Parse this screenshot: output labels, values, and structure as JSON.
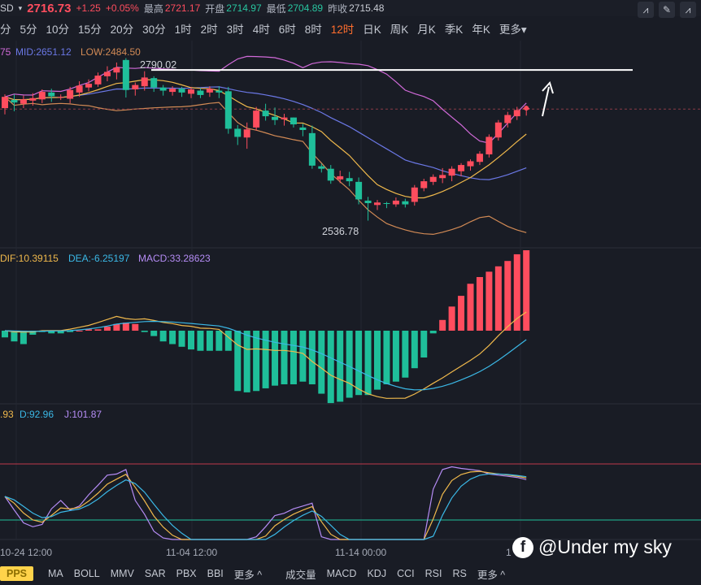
{
  "header": {
    "symbol": "SD",
    "price": "2716.73",
    "change": "+1.25",
    "change_pct": "+0.05%",
    "high_label": "最高",
    "high": "2721.17",
    "open_label": "开盘",
    "open": "2714.97",
    "low_label": "最低",
    "low": "2704.89",
    "prev_label": "昨收",
    "prev": "2715.48"
  },
  "periods": [
    "分",
    "5分",
    "10分",
    "15分",
    "20分",
    "30分",
    "1时",
    "2时",
    "3时",
    "4时",
    "6时",
    "8时",
    "12时",
    "日K",
    "周K",
    "月K",
    "季K",
    "年K",
    "更多"
  ],
  "active_period": "12时",
  "main_indicator": {
    "up": "75",
    "mid": "MID:2651.12",
    "low": "LOW:2484.50"
  },
  "macd_indicator": {
    "dif": "DIF:10.39115",
    "dea": "DEA:-6.25197",
    "macd": "MACD:33.28623"
  },
  "kdj_indicator": {
    "k": ".93",
    "d": "D:92.96",
    "j": "J:101.87"
  },
  "annotations": {
    "high_mark": "2790.02",
    "low_mark": "2536.78"
  },
  "time_axis": [
    "10-24 12:00",
    "11-04 12:00",
    "11-14 00:00",
    "1"
  ],
  "bottom_tabs": {
    "left": [
      "PPS",
      "MA",
      "BOLL",
      "MMV",
      "SAR",
      "PBX",
      "BBI",
      "更多"
    ],
    "right": [
      "成交量",
      "MACD",
      "KDJ",
      "CCI",
      "RSI",
      "RS",
      "更多"
    ]
  },
  "watermark": "@Under my sky",
  "colors": {
    "up": "#ff4d5e",
    "down": "#1fbf9a",
    "mid": "#6b78e6",
    "upper": "#d16ad9",
    "lower": "#d28a55",
    "ma": "#f0b94c",
    "dea": "#3bb8e6",
    "j": "#b58cf5"
  },
  "chart_data": {
    "type": "candlestick",
    "price_range": [
      2500,
      2825
    ],
    "resistance_level": 2778,
    "candles": [
      [
        2717,
        2735,
        2707,
        2739
      ],
      [
        2730,
        2726,
        2712,
        2739
      ],
      [
        2724,
        2731,
        2717,
        2737
      ],
      [
        2729,
        2733,
        2721,
        2741
      ],
      [
        2731,
        2743,
        2725,
        2747
      ],
      [
        2742,
        2736,
        2727,
        2748
      ],
      [
        2735,
        2735,
        2730,
        2739
      ],
      [
        2732,
        2746,
        2725,
        2751
      ],
      [
        2742,
        2753,
        2735,
        2760
      ],
      [
        2750,
        2756,
        2744,
        2763
      ],
      [
        2755,
        2769,
        2751,
        2774
      ],
      [
        2768,
        2775,
        2760,
        2784
      ],
      [
        2774,
        2782,
        2763,
        2790
      ],
      [
        2794,
        2746,
        2734,
        2797
      ],
      [
        2747,
        2754,
        2737,
        2758
      ],
      [
        2752,
        2766,
        2745,
        2776
      ],
      [
        2765,
        2750,
        2743,
        2768
      ],
      [
        2750,
        2745,
        2737,
        2754
      ],
      [
        2743,
        2748,
        2737,
        2752
      ],
      [
        2748,
        2742,
        2735,
        2751
      ],
      [
        2740,
        2747,
        2733,
        2751
      ],
      [
        2745,
        2738,
        2733,
        2749
      ],
      [
        2742,
        2748,
        2735,
        2752
      ],
      [
        2745,
        2742,
        2733,
        2752
      ],
      [
        2744,
        2684,
        2676,
        2751
      ],
      [
        2684,
        2671,
        2658,
        2690
      ],
      [
        2670,
        2683,
        2652,
        2694
      ],
      [
        2686,
        2713,
        2681,
        2719
      ],
      [
        2713,
        2704,
        2697,
        2724
      ],
      [
        2703,
        2698,
        2690,
        2718
      ],
      [
        2699,
        2702,
        2689,
        2708
      ],
      [
        2702,
        2691,
        2686,
        2702
      ],
      [
        2686,
        2682,
        2672,
        2692
      ],
      [
        2677,
        2625,
        2620,
        2689
      ],
      [
        2624,
        2620,
        2614,
        2628
      ],
      [
        2620,
        2601,
        2596,
        2626
      ],
      [
        2603,
        2608,
        2597,
        2617
      ],
      [
        2605,
        2600,
        2592,
        2615
      ],
      [
        2599,
        2571,
        2563,
        2606
      ],
      [
        2569,
        2565,
        2537,
        2575
      ],
      [
        2562,
        2566,
        2554,
        2570
      ],
      [
        2565,
        2564,
        2557,
        2567
      ],
      [
        2563,
        2569,
        2559,
        2574
      ],
      [
        2568,
        2563,
        2558,
        2572
      ],
      [
        2567,
        2590,
        2561,
        2594
      ],
      [
        2589,
        2600,
        2584,
        2604
      ],
      [
        2599,
        2607,
        2594,
        2611
      ],
      [
        2605,
        2610,
        2597,
        2621
      ],
      [
        2609,
        2620,
        2600,
        2624
      ],
      [
        2616,
        2626,
        2608,
        2629
      ],
      [
        2624,
        2632,
        2617,
        2635
      ],
      [
        2631,
        2644,
        2626,
        2648
      ],
      [
        2643,
        2671,
        2638,
        2675
      ],
      [
        2670,
        2694,
        2665,
        2698
      ],
      [
        2693,
        2706,
        2686,
        2711
      ],
      [
        2704,
        2714,
        2698,
        2719
      ],
      [
        2715,
        2717,
        2705,
        2721
      ]
    ],
    "macd_hist": [
      -5,
      -8,
      -10,
      -3,
      -1,
      -2,
      -2,
      -1,
      0,
      1,
      1,
      3,
      5,
      6,
      5,
      -1,
      -4,
      -8,
      -10,
      -12,
      -14,
      -15,
      -15,
      -15,
      -15,
      -45,
      -46,
      -45,
      -43,
      -41,
      -40,
      -40,
      -38,
      -40,
      -47,
      -54,
      -53,
      -50,
      -48,
      -48,
      -44,
      -40,
      -38,
      -35,
      -28,
      -20,
      -2,
      8,
      18,
      26,
      35,
      40,
      44,
      48,
      52,
      57,
      60
    ],
    "kdj_j": [
      42,
      18,
      -5,
      -12,
      -8,
      20,
      35,
      18,
      25,
      45,
      62,
      80,
      82,
      90,
      35,
      10,
      -20,
      -32,
      -42,
      -48,
      -55,
      -62,
      -65,
      -66,
      -62,
      -70,
      -55,
      -30,
      -12,
      8,
      12,
      20,
      25,
      30,
      -30,
      -48,
      -58,
      -62,
      -68,
      -72,
      -80,
      -78,
      -75,
      -68,
      -55,
      -40,
      55,
      90,
      95,
      92,
      90,
      88,
      82,
      80,
      78,
      76,
      72
    ]
  }
}
